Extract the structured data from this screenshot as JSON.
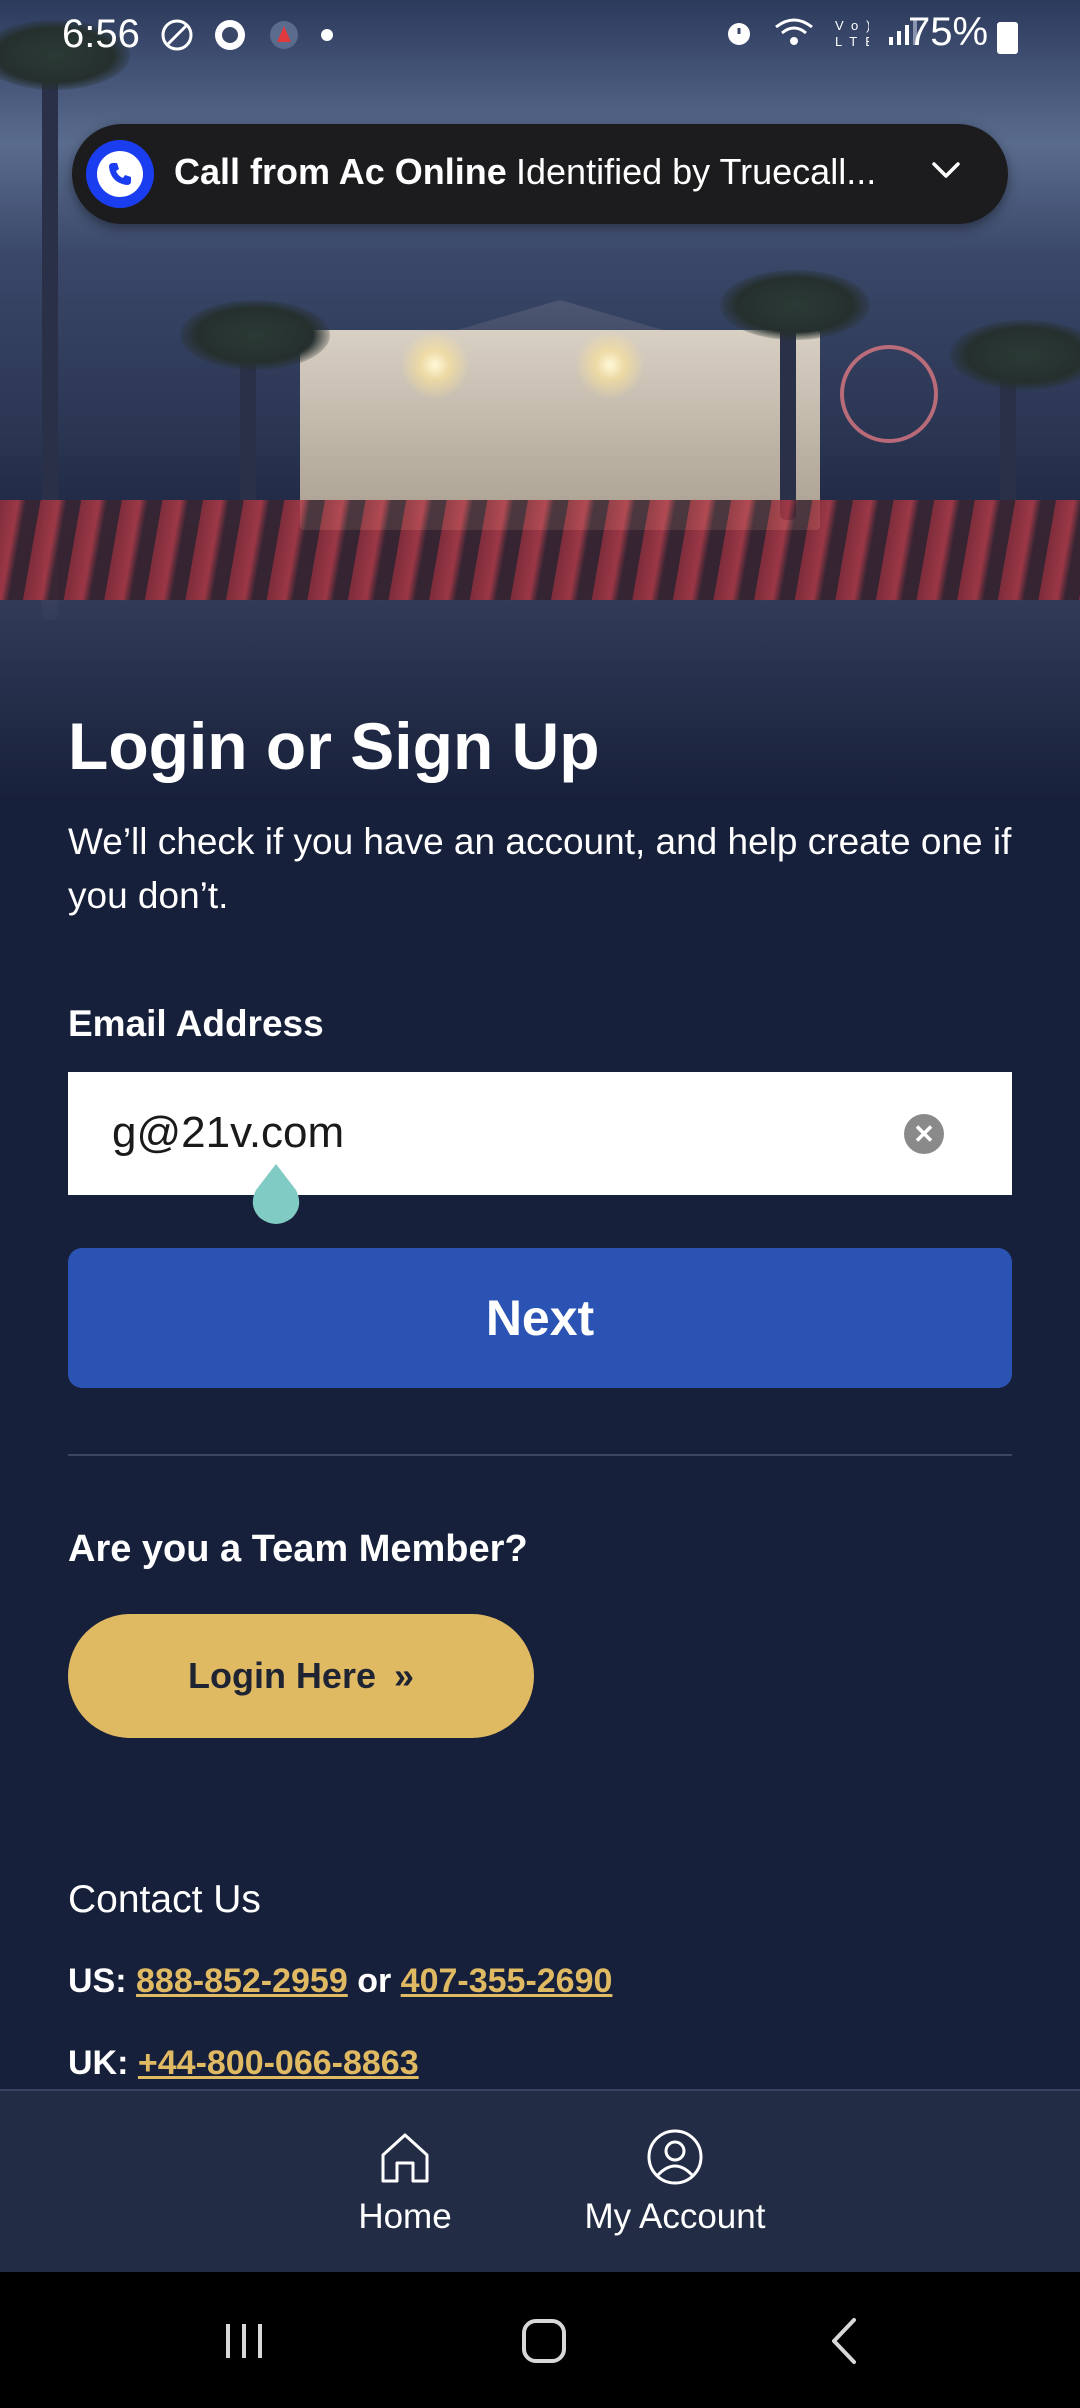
{
  "status_bar": {
    "time": "6:56",
    "left_icons": [
      "do-not-disturb-icon",
      "truecaller-icon",
      "app-notification-icon",
      "dot"
    ],
    "right_icons": [
      "alarm-icon",
      "wifi-icon",
      "volte-icon",
      "signal-icon"
    ],
    "battery": "75%"
  },
  "call_notification": {
    "title": "Call from Ac Online",
    "subtitle": "Identified by Truecall..."
  },
  "login": {
    "heading": "Login or Sign Up",
    "description": "We’ll check if you have an account, and help create one if you don’t.",
    "email_label": "Email Address",
    "email_value": "g@21v.com",
    "next_label": "Next"
  },
  "team": {
    "heading": "Are you a Team Member?",
    "login_label": "Login Here",
    "login_chevron": "»"
  },
  "contact": {
    "heading": "Contact Us",
    "us_label": "US:",
    "us_phone_1": "888-852-2959",
    "or": "or",
    "us_phone_2": "407-355-2690",
    "uk_label": "UK:",
    "uk_phone": "+44-800-066-8863"
  },
  "bottom_nav": {
    "home_label": "Home",
    "account_label": "My Account"
  },
  "colors": {
    "background": "#17203a",
    "primary_button": "#2a53b3",
    "accent_gold": "#e0b963",
    "nav_bar": "#232c45"
  }
}
